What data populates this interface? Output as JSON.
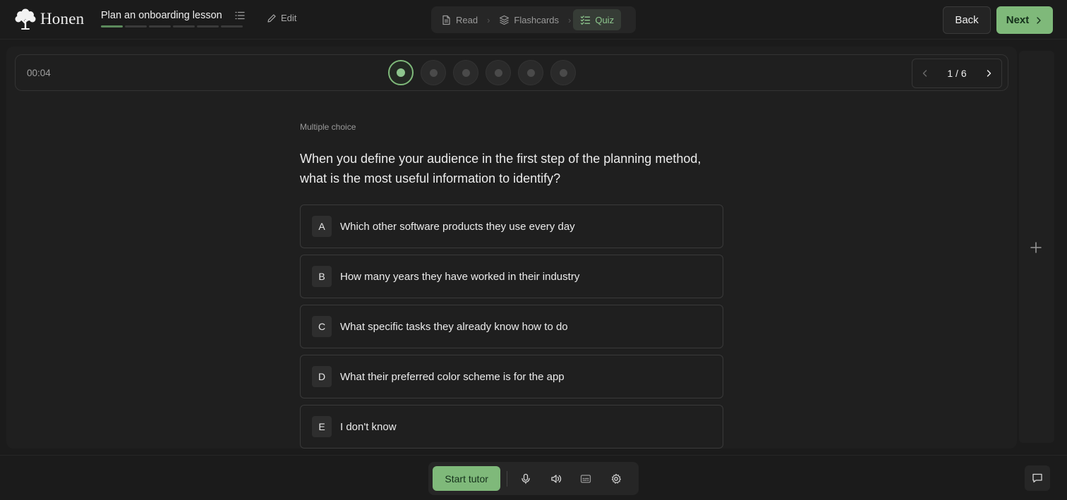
{
  "brand": {
    "name": "Honen",
    "icon": "tree-icon"
  },
  "lesson": {
    "title": "Plan an onboarding lesson",
    "progress_total": 6,
    "progress_done": 1
  },
  "toolbar": {
    "edit_label": "Edit"
  },
  "modes": [
    {
      "label": "Read",
      "icon": "document-icon",
      "active": false
    },
    {
      "label": "Flashcards",
      "icon": "layers-icon",
      "active": false
    },
    {
      "label": "Quiz",
      "icon": "checklist-icon",
      "active": true
    }
  ],
  "nav": {
    "back_label": "Back",
    "next_label": "Next"
  },
  "quiz": {
    "timer": "00:04",
    "total_questions": 6,
    "current_index": 1,
    "pager_text": "1 / 6",
    "question_type": "Multiple choice",
    "question": "When you define your audience in the first step of the planning method, what is the most useful information to identify?",
    "options": [
      {
        "letter": "A",
        "text": "Which other software products they use every day"
      },
      {
        "letter": "B",
        "text": "How many years they have worked in their industry"
      },
      {
        "letter": "C",
        "text": "What specific tasks they already know how to do"
      },
      {
        "letter": "D",
        "text": "What their preferred color scheme is for the app"
      },
      {
        "letter": "E",
        "text": "I don't know"
      }
    ]
  },
  "bottom": {
    "tutor_label": "Start tutor",
    "tools": [
      "microphone-icon",
      "speaker-icon",
      "captions-icon",
      "gear-icon"
    ]
  },
  "colors": {
    "accent": "#7fb97a",
    "background": "#1b1b1b",
    "panel": "#1f1f1f"
  }
}
